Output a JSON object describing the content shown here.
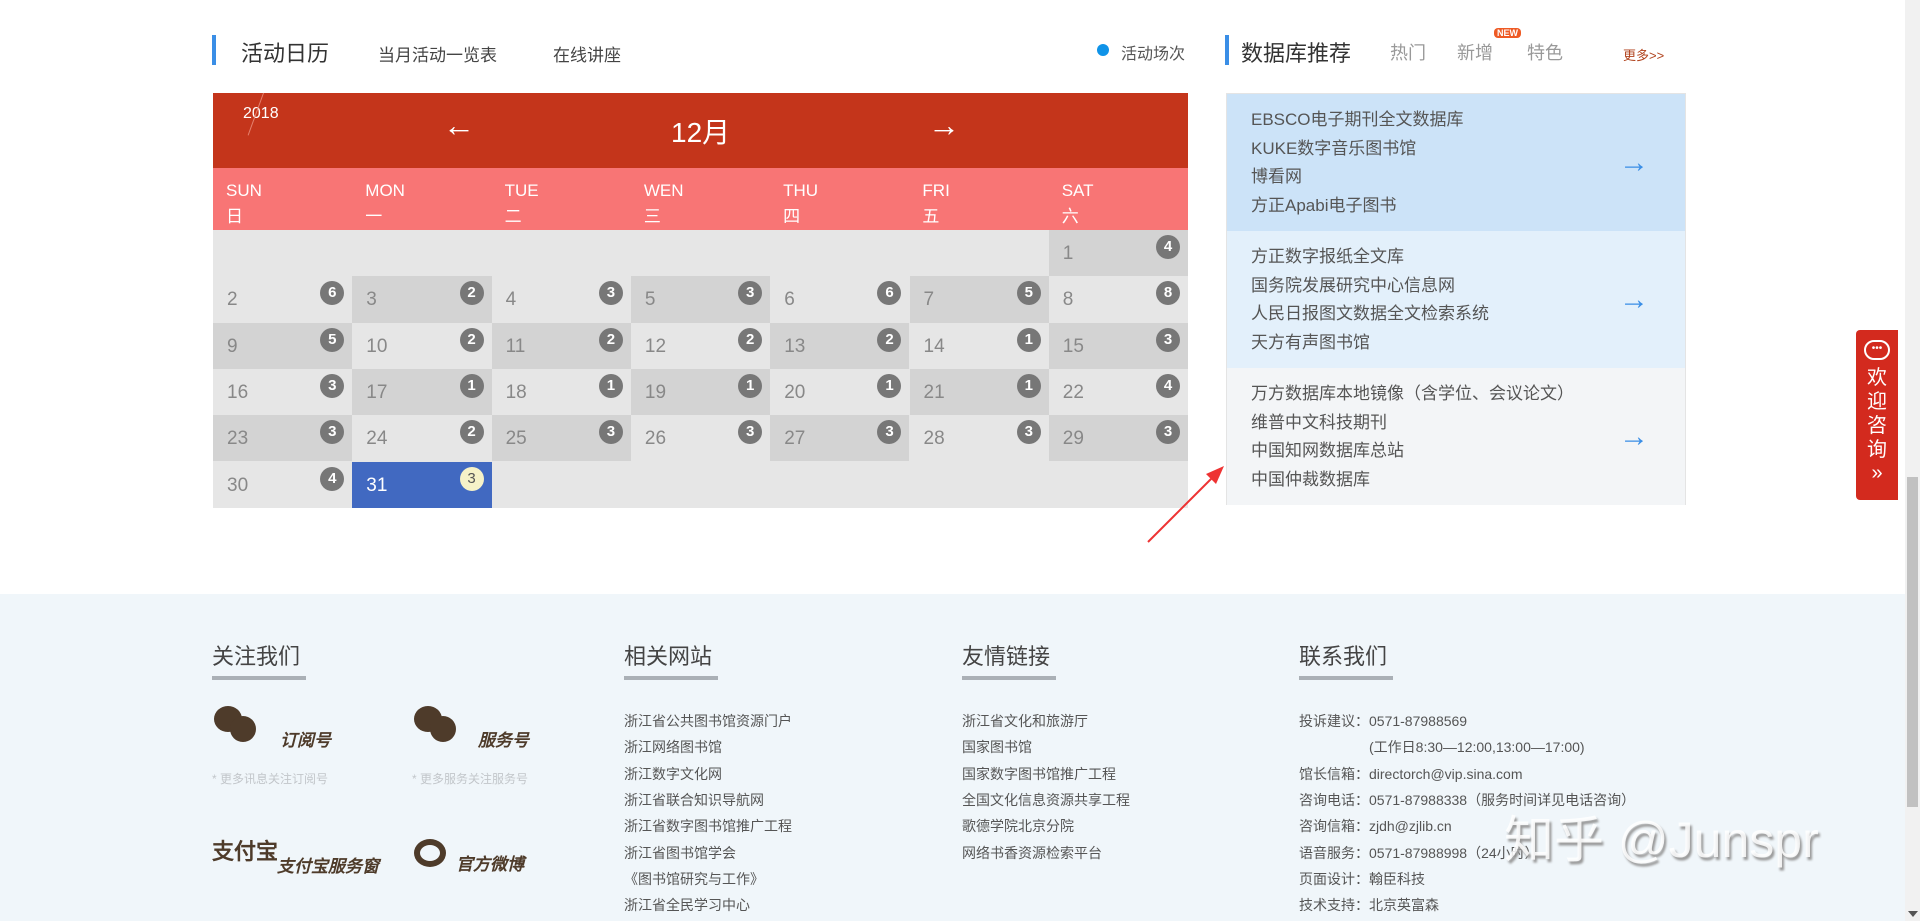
{
  "activity": {
    "title": "活动日历",
    "tabs": [
      "当月活动一览表",
      "在线讲座"
    ],
    "legend": "活动场次"
  },
  "calendar": {
    "year": "2018",
    "month": "12月",
    "prev_icon": "←",
    "next_icon": "→",
    "weekdays": [
      {
        "en": "SUN",
        "zh": "日"
      },
      {
        "en": "MON",
        "zh": "一"
      },
      {
        "en": "TUE",
        "zh": "二"
      },
      {
        "en": "WEN",
        "zh": "三"
      },
      {
        "en": "THU",
        "zh": "四"
      },
      {
        "en": "FRI",
        "zh": "五"
      },
      {
        "en": "SAT",
        "zh": "六"
      }
    ],
    "first_weekday": 6,
    "days": [
      {
        "d": "1",
        "c": "4"
      },
      {
        "d": "2",
        "c": "6"
      },
      {
        "d": "3",
        "c": "2"
      },
      {
        "d": "4",
        "c": "3"
      },
      {
        "d": "5",
        "c": "3"
      },
      {
        "d": "6",
        "c": "6"
      },
      {
        "d": "7",
        "c": "5"
      },
      {
        "d": "8",
        "c": "8"
      },
      {
        "d": "9",
        "c": "5"
      },
      {
        "d": "10",
        "c": "2"
      },
      {
        "d": "11",
        "c": "2"
      },
      {
        "d": "12",
        "c": "2"
      },
      {
        "d": "13",
        "c": "2"
      },
      {
        "d": "14",
        "c": "1"
      },
      {
        "d": "15",
        "c": "3"
      },
      {
        "d": "16",
        "c": "3"
      },
      {
        "d": "17",
        "c": "1"
      },
      {
        "d": "18",
        "c": "1"
      },
      {
        "d": "19",
        "c": "1"
      },
      {
        "d": "20",
        "c": "1"
      },
      {
        "d": "21",
        "c": "1"
      },
      {
        "d": "22",
        "c": "4"
      },
      {
        "d": "23",
        "c": "3"
      },
      {
        "d": "24",
        "c": "2"
      },
      {
        "d": "25",
        "c": "3"
      },
      {
        "d": "26",
        "c": "3"
      },
      {
        "d": "27",
        "c": "3"
      },
      {
        "d": "28",
        "c": "3"
      },
      {
        "d": "29",
        "c": "3"
      },
      {
        "d": "30",
        "c": "4"
      },
      {
        "d": "31",
        "c": "3"
      }
    ],
    "today": "31"
  },
  "database": {
    "title": "数据库推荐",
    "tabs": [
      "热门",
      "新增",
      "特色"
    ],
    "new_badge": "NEW",
    "more": "更多>>",
    "groups": [
      {
        "bg": "#cce3f8",
        "items": [
          "EBSCO电子期刊全文数据库",
          "KUKE数字音乐图书馆",
          "博看网",
          "方正Apabi电子图书"
        ]
      },
      {
        "bg": "#e3f0fb",
        "items": [
          "方正数字报纸全文库",
          "国务院发展研究中心信息网",
          "人民日报图文数据全文检索系统",
          "天方有声图书馆"
        ]
      },
      {
        "bg": "#f3f5f7",
        "items": [
          "万方数据库本地镜像（含学位、会议论文）",
          "维普中文科技期刊",
          "中国知网数据库总站",
          "中国仲裁数据库"
        ]
      }
    ]
  },
  "consult": {
    "label": "欢迎咨询",
    "icon": "»"
  },
  "footer": {
    "follow": {
      "title": "关注我们",
      "subscribe": "订阅号",
      "service": "服务号",
      "subscribe_hint": "* 更多讯息关注订阅号",
      "service_hint": "* 更多服务关注服务号",
      "alipay_logo": "支付宝",
      "alipay": "支付宝服务窗",
      "weibo": "官方微博"
    },
    "related": {
      "title": "相关网站",
      "links": [
        "浙江省公共图书馆资源门户",
        "浙江网络图书馆",
        "浙江数字文化网",
        "浙江省联合知识导航网",
        "浙江省数字图书馆推广工程",
        "浙江省图书馆学会",
        "《图书馆研究与工作》",
        "浙江省全民学习中心"
      ]
    },
    "friends": {
      "title": "友情链接",
      "links": [
        "浙江省文化和旅游厅",
        "国家图书馆",
        "国家数字图书馆推广工程",
        "全国文化信息资源共享工程",
        "歌德学院北京分院",
        "网络书香资源检索平台"
      ]
    },
    "contact": {
      "title": "联系我们",
      "rows": [
        "投诉建议：0571-87988569",
        "　　　　　(工作日8:30—12:00,13:00—17:00)",
        "馆长信箱：directorch@vip.sina.com",
        "咨询电话：0571-87988338（服务时间详见电话咨询）",
        "咨询信箱：zjdh@zjlib.cn",
        "语音服务：0571-87988998（24小时）",
        "页面设计：翰臣科技",
        "技术支持：北京英富森"
      ]
    }
  },
  "watermark": "知乎 @Junspr"
}
